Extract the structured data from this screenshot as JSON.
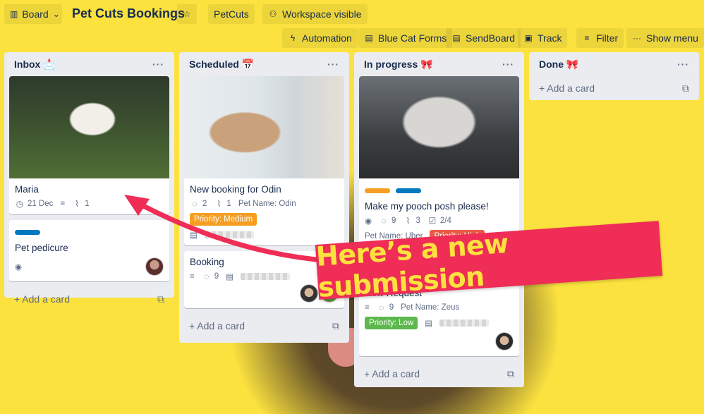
{
  "header": {
    "view_button": "Board",
    "board_title": "Pet Cuts Bookings",
    "workspace_button": "PetCuts",
    "visibility_button": "Workspace visible",
    "automation": "Automation",
    "blue_cat_forms": "Blue Cat Forms",
    "sendboard": "SendBoard",
    "track": "Track",
    "filter": "Filter",
    "show_menu": "Show menu"
  },
  "lists": [
    {
      "title": "Inbox 📩",
      "add_card": "Add a card",
      "cards": [
        {
          "title": "Maria",
          "due": "21 Dec",
          "attachments": "1"
        },
        {
          "title": "Pet pedicure"
        }
      ]
    },
    {
      "title": "Scheduled 📅",
      "add_card": "Add a card",
      "cards": [
        {
          "title": "New booking for Odin",
          "comments": "2",
          "attachments": "1",
          "field": "Pet Name: Odin",
          "priority": "Priority: Medium"
        },
        {
          "title": "Booking",
          "comments": "9"
        }
      ]
    },
    {
      "title": "In progress 🎀",
      "add_card": "Add a card",
      "cards": [
        {
          "title": "Make my pooch posh please!",
          "comments": "9",
          "attachments": "3",
          "checklist": "2/4",
          "field": "Pet Name: Uber",
          "priority": "Priority: High"
        },
        {
          "title": "New Request",
          "comments": "9",
          "field": "Pet Name: Zeus",
          "priority": "Priority: Low"
        }
      ]
    },
    {
      "title": "Done 🎀",
      "add_card": "Add a card",
      "cards": []
    }
  ],
  "overlay": {
    "banner_text": "Here’s a new submission"
  },
  "colors": {
    "background": "#fbe23f",
    "banner": "#ef2d56",
    "banner_text": "#fde23e",
    "priority_medium": "#f59e22",
    "priority_high": "#eb5a46",
    "priority_low": "#5cb84c",
    "label_blue": "#0079bf",
    "label_orange": "#f59e22"
  }
}
